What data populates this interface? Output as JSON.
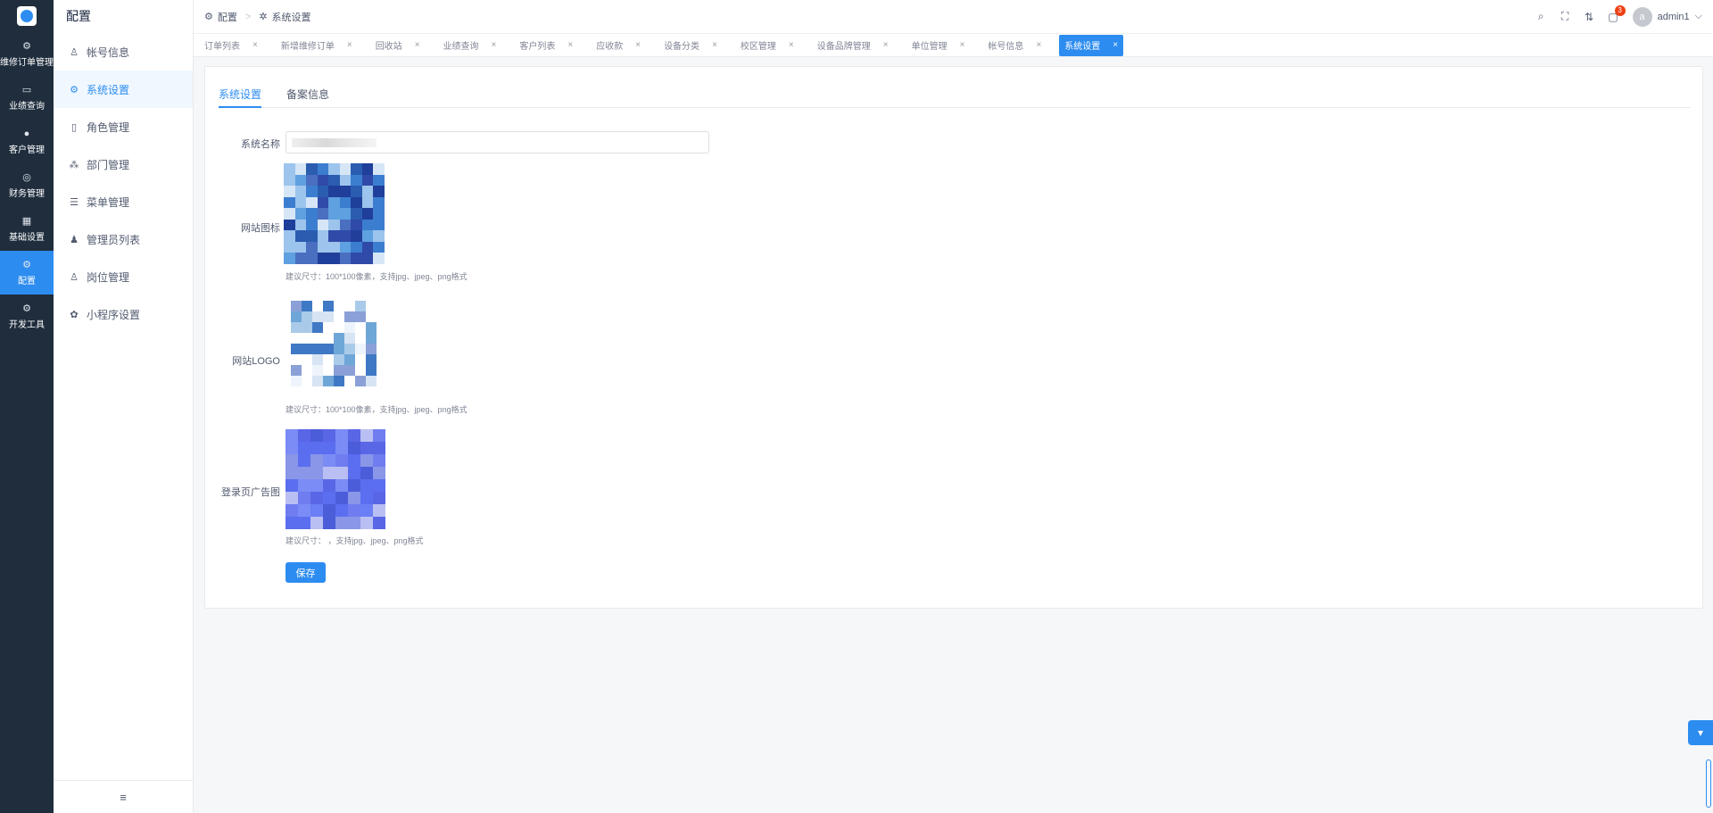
{
  "rail": {
    "items": [
      {
        "label": "维修订单管理",
        "icon": "chip-icon",
        "glyph": "⚙"
      },
      {
        "label": "业绩查询",
        "icon": "chart-icon",
        "glyph": "▭"
      },
      {
        "label": "客户管理",
        "icon": "user-icon",
        "glyph": "●"
      },
      {
        "label": "财务管理",
        "icon": "database-icon",
        "glyph": "◎"
      },
      {
        "label": "基础设置",
        "icon": "grid-icon",
        "glyph": "▦"
      },
      {
        "label": "配置",
        "icon": "settings-icon",
        "glyph": "⚙"
      },
      {
        "label": "开发工具",
        "icon": "settings-icon",
        "glyph": "⚙"
      }
    ],
    "active_index": 5
  },
  "sidebar": {
    "title": "配置",
    "items": [
      {
        "label": "帐号信息",
        "icon": "user-outline-icon",
        "glyph": "♙"
      },
      {
        "label": "系统设置",
        "icon": "gear-icon",
        "glyph": "⚙"
      },
      {
        "label": "角色管理",
        "icon": "book-icon",
        "glyph": "▯"
      },
      {
        "label": "部门管理",
        "icon": "org-icon",
        "glyph": "⁂"
      },
      {
        "label": "菜单管理",
        "icon": "menu-list-icon",
        "glyph": "☰"
      },
      {
        "label": "管理员列表",
        "icon": "admin-icon",
        "glyph": "♟"
      },
      {
        "label": "岗位管理",
        "icon": "user-outline-icon",
        "glyph": "♙"
      },
      {
        "label": "小程序设置",
        "icon": "wechat-icon",
        "glyph": "✿"
      }
    ],
    "active_index": 1,
    "collapse_glyph": "≡"
  },
  "header": {
    "breadcrumb": [
      {
        "label": "配置",
        "glyph": "⚙"
      },
      {
        "label": "系统设置",
        "glyph": "✲"
      }
    ],
    "breadcrumb_sep": ">",
    "icons": [
      {
        "name": "search-icon",
        "glyph": "⌕"
      },
      {
        "name": "fullscreen-icon",
        "glyph": "⛶"
      },
      {
        "name": "translate-icon",
        "glyph": "⇅"
      },
      {
        "name": "notification-icon",
        "glyph": "▢",
        "badge": "3"
      }
    ],
    "user": {
      "avatar_letter": "a",
      "name": "admin1",
      "caret": "⌵"
    }
  },
  "tabs": {
    "items": [
      "订单列表",
      "新增维修订单",
      "回收站",
      "业绩查询",
      "客户列表",
      "应收款",
      "设备分类",
      "校区管理",
      "设备品牌管理",
      "单位管理",
      "帐号信息",
      "系统设置"
    ],
    "active_index": 11,
    "close_glyph": "×"
  },
  "content": {
    "tabs": [
      "系统设置",
      "备案信息"
    ],
    "active_tab": 0,
    "form": {
      "name_label": "系统名称",
      "favicon_label": "网站图标",
      "logo_label": "网站LOGO",
      "login_ad_label": "登录页广告图",
      "hint_favicon": "建议尺寸：100*100像素，支持jpg、jpeg、png格式",
      "hint_logo": "建议尺寸：100*100像素，支持jpg、jpeg、png格式",
      "hint_login_ad": "建议尺寸：          ，支持jpg、jpeg、png格式",
      "save_label": "保存"
    }
  },
  "floating": {
    "glyph": "▾"
  },
  "colors": {
    "primary": "#2d8cf0",
    "rail_bg": "#1f2d3d"
  }
}
